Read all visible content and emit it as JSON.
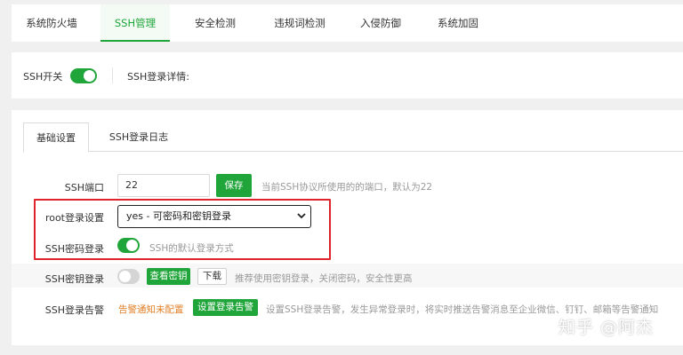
{
  "nav": {
    "items": [
      {
        "label": "系统防火墙"
      },
      {
        "label": "SSH管理"
      },
      {
        "label": "安全检测"
      },
      {
        "label": "违规词检测"
      },
      {
        "label": "入侵防御"
      },
      {
        "label": "系统加固"
      }
    ],
    "active_index": 1
  },
  "ssh_switch": {
    "label": "SSH开关",
    "state": "on",
    "details_label": "SSH登录详情:"
  },
  "tabs": [
    {
      "label": "基础设置",
      "active": true
    },
    {
      "label": "SSH登录日志",
      "active": false
    }
  ],
  "settings": {
    "port": {
      "label": "SSH端口",
      "value": "22",
      "save_label": "保存",
      "hint": "当前SSH协议所使用的的端口，默认为22"
    },
    "root_login": {
      "label": "root登录设置",
      "selected": "yes - 可密码和密钥登录"
    },
    "password_login": {
      "label": "SSH密码登录",
      "state": "on",
      "hint": "SSH的默认登录方式"
    },
    "key_login": {
      "label": "SSH密钥登录",
      "state": "off",
      "view_key_label": "查看密钥",
      "download_label": "下载",
      "hint": "推荐使用密钥登录，关闭密码，安全性更高"
    },
    "login_alert": {
      "label": "SSH登录告警",
      "status": "告警通知未配置",
      "set_alert_label": "设置登录告警",
      "hint": "设置SSH登录告警，发生异常登录时，将实时推送告警消息至企业微信、钉钉、邮箱等告警通知"
    }
  },
  "watermark": "知乎 @阿杰",
  "colors": {
    "accent": "#20a53a",
    "highlight_border": "#e0242c",
    "warning_text": "#e28028"
  }
}
